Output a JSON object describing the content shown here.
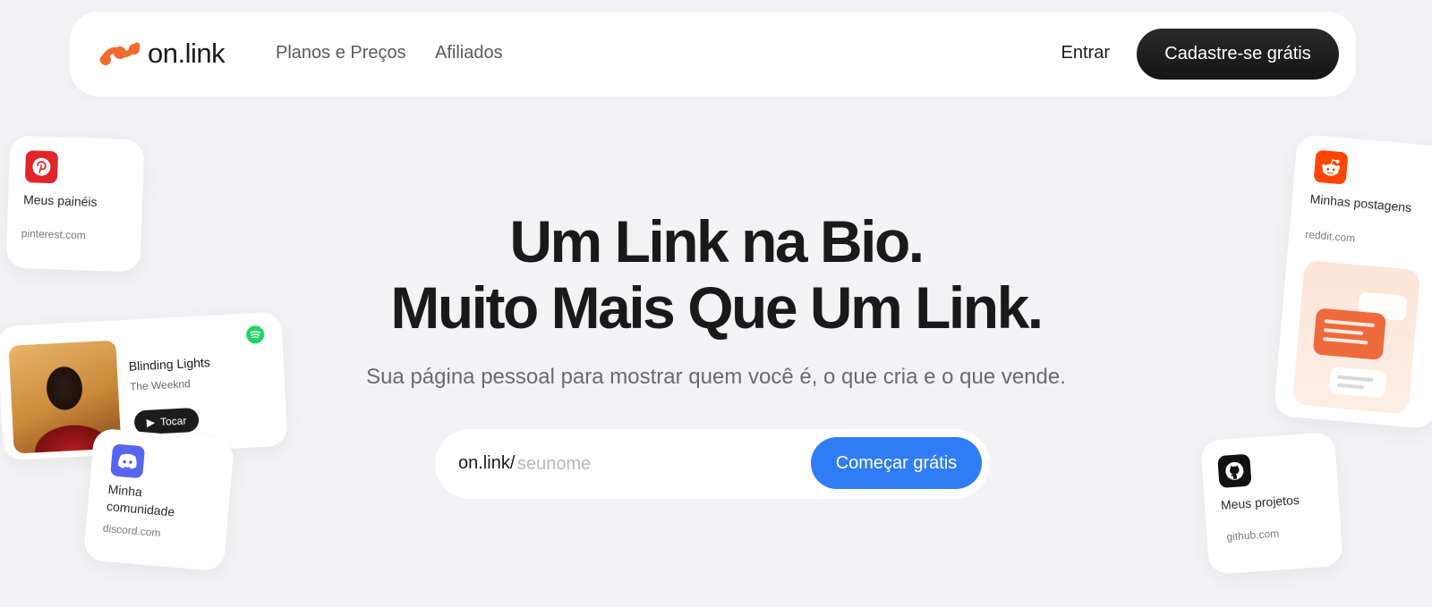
{
  "nav": {
    "logo_text": "on.link",
    "links": [
      "Planos e Preços",
      "Afiliados"
    ],
    "login": "Entrar",
    "signup": "Cadastre-se grátis"
  },
  "hero": {
    "title_line1": "Um Link na Bio.",
    "title_line2": "Muito Mais Que Um Link.",
    "subtitle": "Sua página pessoal para mostrar quem você é, o que cria e o que vende."
  },
  "signup_form": {
    "prefix": "on.link/",
    "placeholder": "seunome",
    "button": "Começar grátis"
  },
  "cards": {
    "pinterest": {
      "icon": "pinterest-icon",
      "title": "Meus painéis",
      "url": "pinterest.com"
    },
    "spotify": {
      "icon": "spotify-icon",
      "song": "Blinding Lights",
      "artist": "The Weeknd",
      "play": "Tocar"
    },
    "discord": {
      "icon": "discord-icon",
      "title": "Minha comunidade",
      "url": "discord.com"
    },
    "reddit": {
      "icon": "reddit-icon",
      "title": "Minhas postagens",
      "url": "reddit.com"
    },
    "github": {
      "icon": "github-icon",
      "title": "Meus projetos",
      "url": "github.com"
    }
  },
  "colors": {
    "background": "#f3f3f5",
    "brand_orange": "#f26b2d",
    "cta_dark": "#1c1c1e",
    "cta_blue": "#2f7cf6"
  }
}
